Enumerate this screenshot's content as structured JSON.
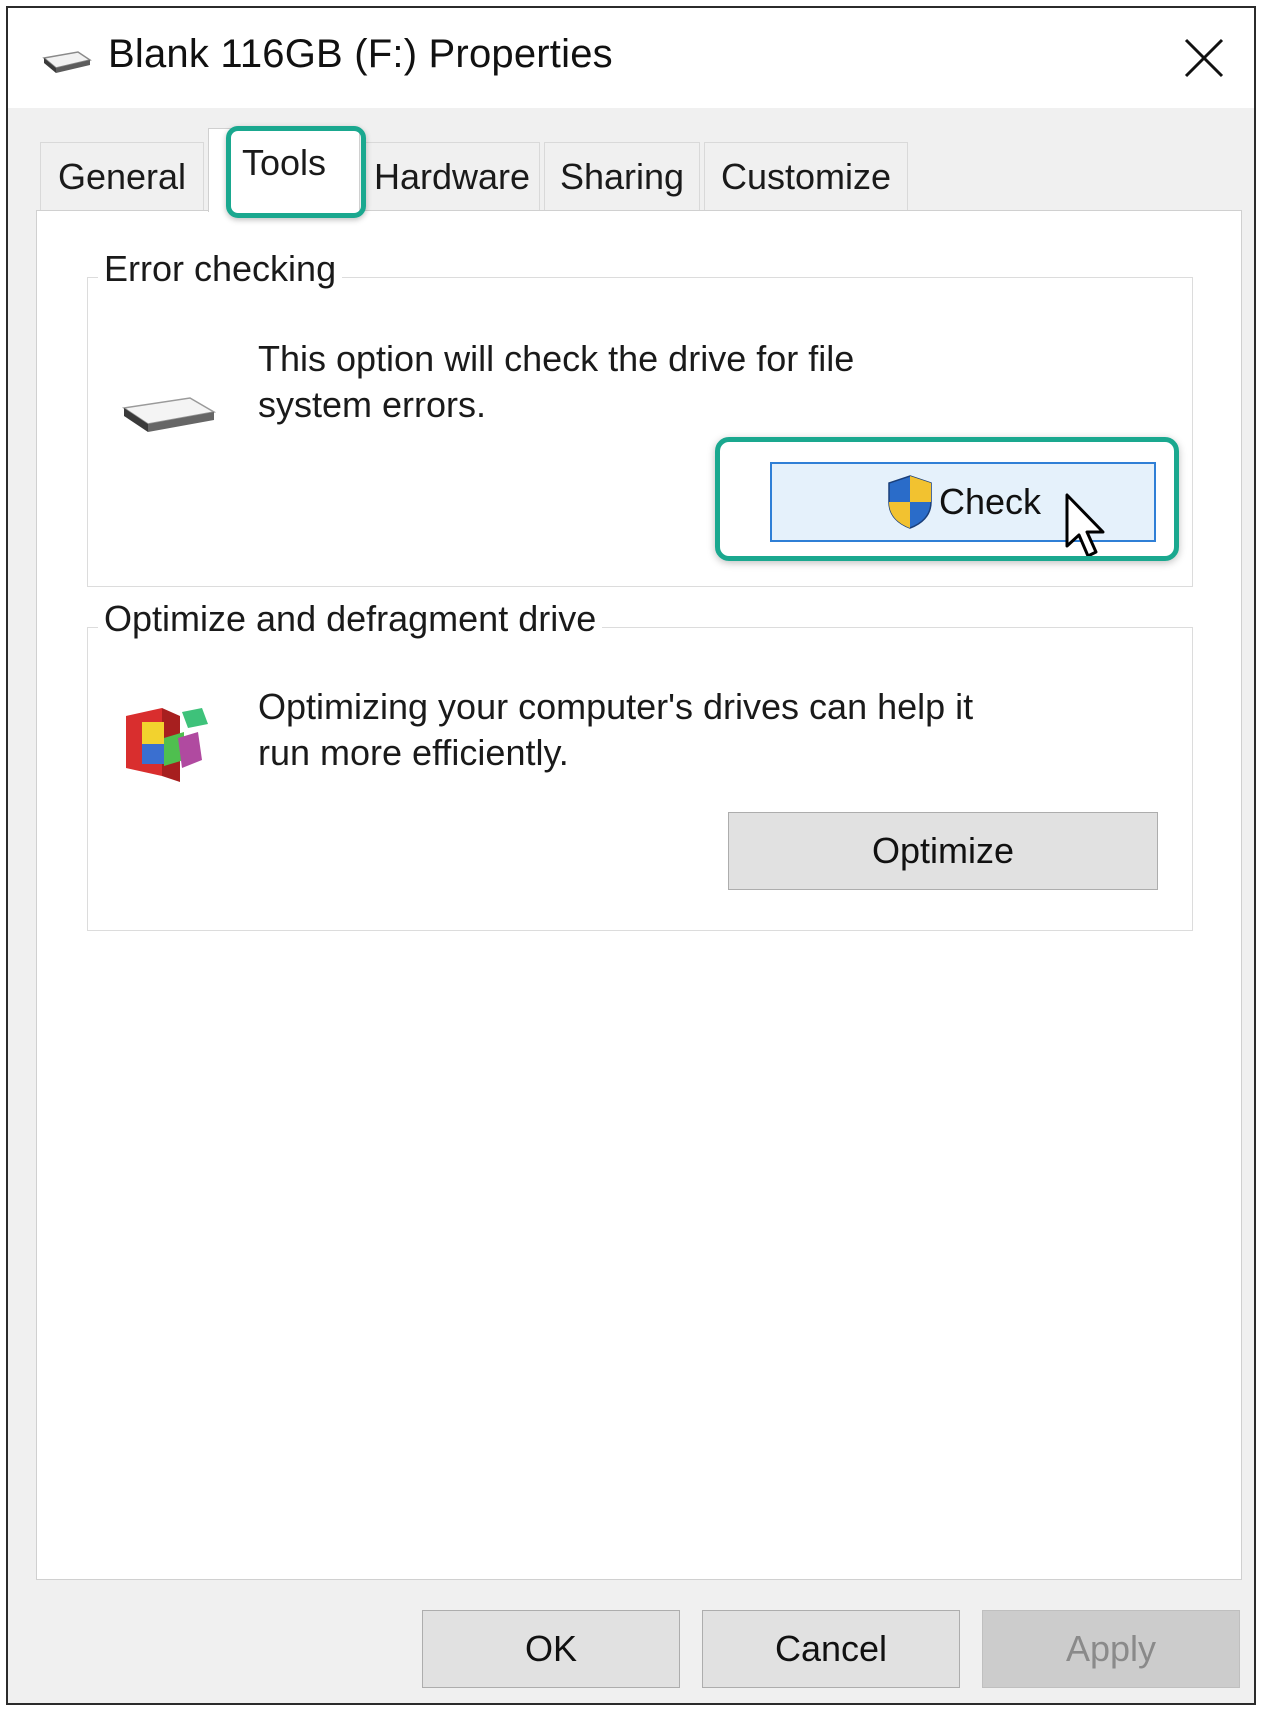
{
  "window": {
    "title": "Blank 116GB (F:) Properties",
    "close_icon": "close-icon"
  },
  "tabs": [
    {
      "label": "General",
      "active": false
    },
    {
      "label": "Tools",
      "active": true
    },
    {
      "label": "Hardware",
      "active": false
    },
    {
      "label": "Sharing",
      "active": false
    },
    {
      "label": "Customize",
      "active": false
    }
  ],
  "error_checking": {
    "label": "Error checking",
    "description_line1": "This option will check the drive for file",
    "description_line2": "system errors.",
    "button_label": "Check",
    "icon": "drive-icon",
    "button_icon": "uac-shield-icon"
  },
  "optimize": {
    "label": "Optimize and defragment drive",
    "description_line1": "Optimizing your computer's drives can help it",
    "description_line2": "run more efficiently.",
    "button_label": "Optimize",
    "icon": "defrag-icon"
  },
  "footer": {
    "ok_label": "OK",
    "cancel_label": "Cancel",
    "apply_label": "Apply"
  },
  "colors": {
    "highlight": "#1aa88f",
    "check_button_border": "#2f7fd6"
  }
}
